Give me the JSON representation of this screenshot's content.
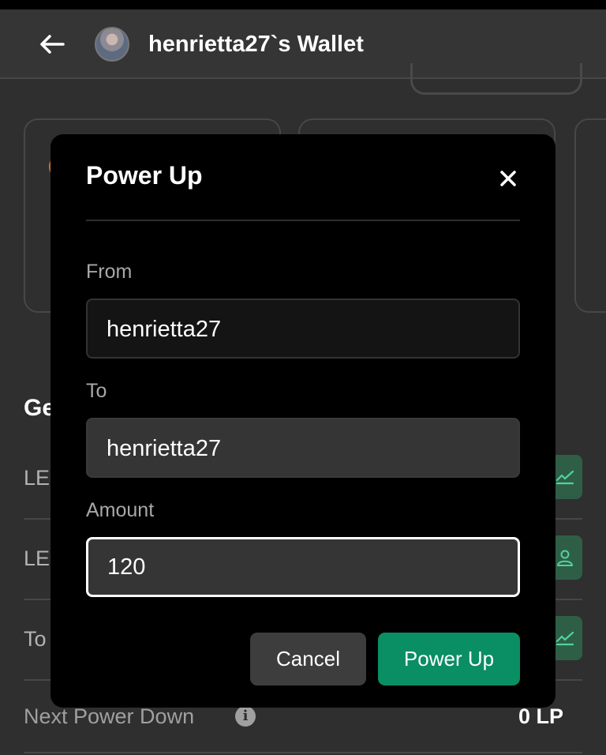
{
  "header": {
    "title": "henrietta27`s Wallet",
    "back_icon": "arrow-left-icon",
    "avatar_icon": "user-avatar"
  },
  "background": {
    "section_title_partial": "Ge",
    "rows": [
      {
        "label_partial": "LE",
        "icon": "chart-icon"
      },
      {
        "label_partial": "LE",
        "icon": "user-icon"
      },
      {
        "label_partial": "To",
        "icon": "chart-icon"
      }
    ],
    "next_power_down": {
      "label": "Next Power Down",
      "value": "0 LP",
      "info_icon": "info-icon"
    },
    "accent_color": "#2f5e47"
  },
  "modal": {
    "title": "Power Up",
    "close_icon": "close-icon",
    "from": {
      "label": "From",
      "value": "henrietta27"
    },
    "to": {
      "label": "To",
      "value": "henrietta27"
    },
    "amount": {
      "label": "Amount",
      "value": "120"
    },
    "cancel_label": "Cancel",
    "submit_label": "Power Up",
    "submit_color": "#0a8e63"
  }
}
